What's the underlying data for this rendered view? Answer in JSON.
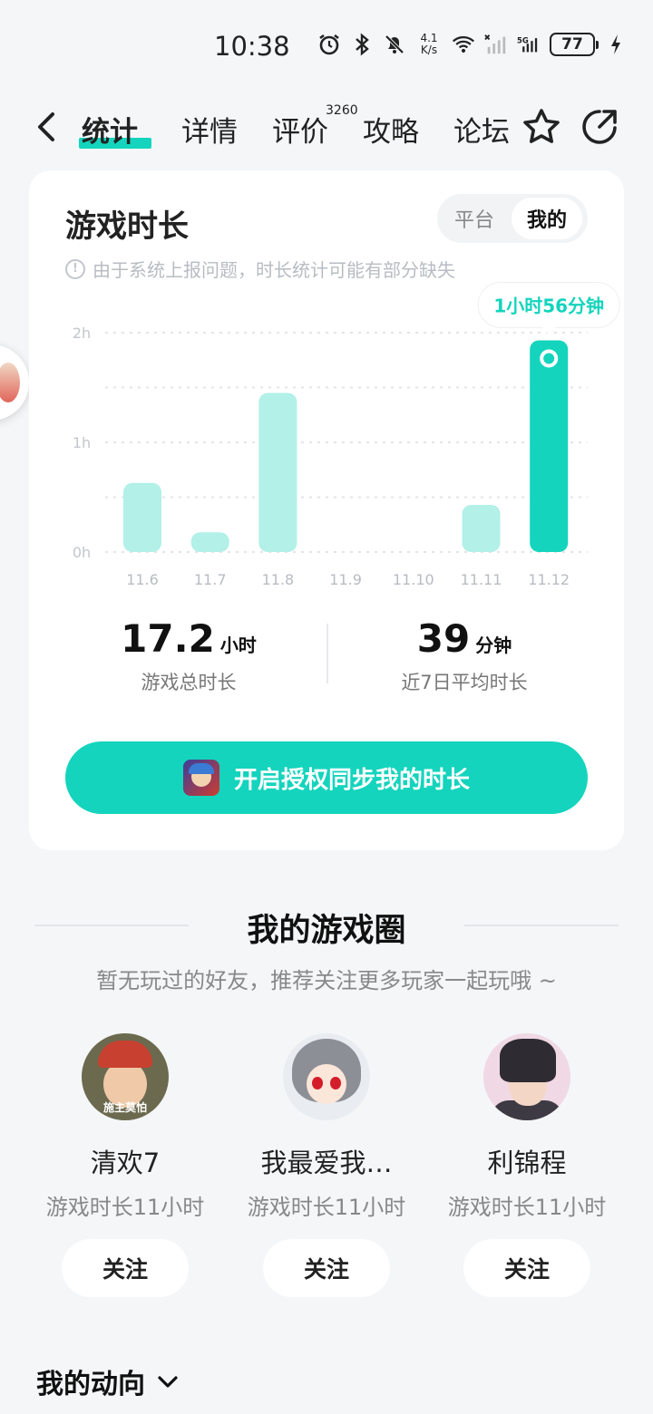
{
  "status_bar": {
    "time": "10:38",
    "net_speed_value": "4.1",
    "net_speed_unit": "K/s",
    "battery": "77"
  },
  "nav": {
    "tabs": [
      {
        "label": "统计"
      },
      {
        "label": "详情"
      },
      {
        "label": "评价"
      },
      {
        "label": "攻略"
      },
      {
        "label": "论坛"
      }
    ],
    "review_badge": "3260"
  },
  "card": {
    "title": "游戏时长",
    "toggle": {
      "platform": "平台",
      "mine": "我的"
    },
    "notice": "由于系统上报问题，时长统计可能有部分缺失",
    "tooltip": "1小时56分钟",
    "stats": {
      "total_value": "17.2",
      "total_unit": "小时",
      "total_label": "游戏总时长",
      "avg_value": "39",
      "avg_unit": "分钟",
      "avg_label": "近7日平均时长"
    },
    "sync_button": "开启授权同步我的时长"
  },
  "chart_data": {
    "type": "bar",
    "categories": [
      "11.6",
      "11.7",
      "11.8",
      "11.9",
      "11.10",
      "11.11",
      "11.12"
    ],
    "values": [
      0.63,
      0.18,
      1.45,
      0,
      0,
      0.43,
      1.93
    ],
    "y_ticks": [
      "0h",
      "1h",
      "2h"
    ],
    "ylim": [
      0,
      2
    ],
    "highlight_index": 6,
    "colors": {
      "bar": "#b2f0e8",
      "highlight": "#14d4bd",
      "grid": "#e1e4e8"
    }
  },
  "circle": {
    "title": "我的游戏圈",
    "subtitle": "暂无玩过的好友，推荐关注更多玩家一起玩哦 ~",
    "friends": [
      {
        "name": "清欢7",
        "playtime": "游戏时长11小时",
        "avatar_text": "施主莫怕",
        "follow": "关注"
      },
      {
        "name": "我最爱我…",
        "playtime": "游戏时长11小时",
        "follow": "关注"
      },
      {
        "name": "利锦程",
        "playtime": "游戏时长11小时",
        "follow": "关注"
      }
    ]
  },
  "dynamics": {
    "label": "我的动向"
  },
  "colors": {
    "accent": "#14d4bd",
    "background": "#f4f6f8"
  }
}
